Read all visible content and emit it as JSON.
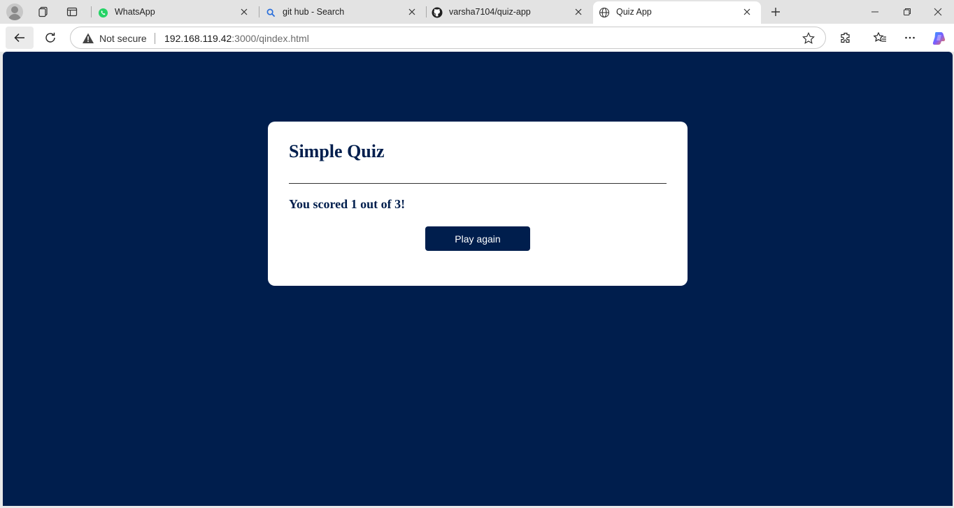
{
  "browser": {
    "tabs": [
      {
        "title": "WhatsApp",
        "icon": "whatsapp-icon",
        "active": false
      },
      {
        "title": "git hub - Search",
        "icon": "search-icon",
        "active": false
      },
      {
        "title": "varsha7104/quiz-app",
        "icon": "github-icon",
        "active": false
      },
      {
        "title": "Quiz App",
        "icon": "globe-icon",
        "active": true
      }
    ],
    "security_label": "Not secure",
    "url_host": "192.168.119.42",
    "url_rest": ":3000/qindex.html"
  },
  "quiz": {
    "title": "Simple Quiz",
    "score_text": "You scored 1 out of 3!",
    "play_again_label": "Play again"
  },
  "colors": {
    "page_background": "#001e4d",
    "card_background": "#ffffff",
    "accent": "#001e4d"
  }
}
